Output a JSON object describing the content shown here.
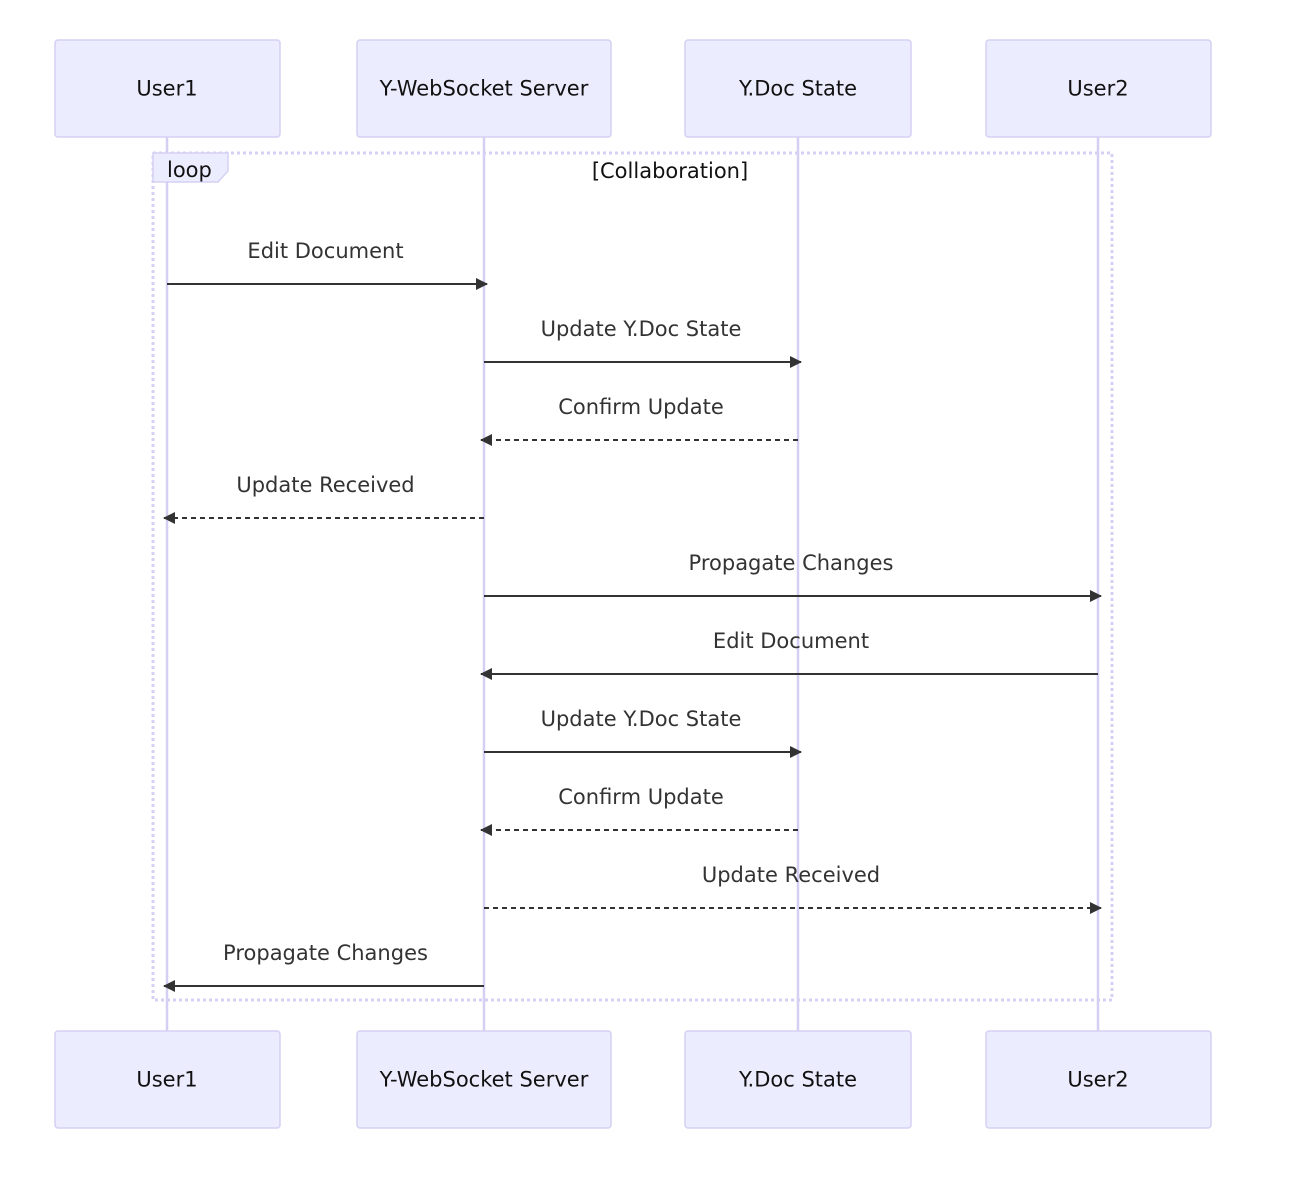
{
  "diagram": {
    "type": "sequence",
    "participants": [
      "User1",
      "Y-WebSocket Server",
      "Y.Doc State",
      "User2"
    ],
    "loop": {
      "keyword": "loop",
      "label": "[Collaboration]"
    },
    "messages": [
      {
        "from": 0,
        "to": 1,
        "text": "Edit Document",
        "style": "solid"
      },
      {
        "from": 1,
        "to": 2,
        "text": "Update Y.Doc State",
        "style": "solid"
      },
      {
        "from": 2,
        "to": 1,
        "text": "Confirm Update",
        "style": "dashed"
      },
      {
        "from": 1,
        "to": 0,
        "text": "Update Received",
        "style": "dashed"
      },
      {
        "from": 1,
        "to": 3,
        "text": "Propagate Changes",
        "style": "solid"
      },
      {
        "from": 3,
        "to": 1,
        "text": "Edit Document",
        "style": "solid"
      },
      {
        "from": 1,
        "to": 2,
        "text": "Update Y.Doc State",
        "style": "solid"
      },
      {
        "from": 2,
        "to": 1,
        "text": "Confirm Update",
        "style": "dashed"
      },
      {
        "from": 1,
        "to": 3,
        "text": "Update Received",
        "style": "dashed"
      },
      {
        "from": 1,
        "to": 0,
        "text": "Propagate Changes",
        "style": "solid"
      }
    ]
  }
}
